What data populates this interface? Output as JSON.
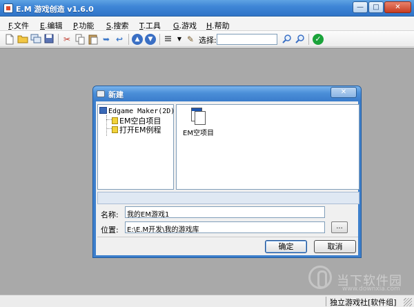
{
  "window": {
    "title": "E.M 游戏创造 v1.6.0",
    "buttons": {
      "minimize": "—",
      "maximize": "□",
      "close": "✕"
    }
  },
  "menu": {
    "items": [
      {
        "key": "F",
        "label": ".文件"
      },
      {
        "key": "E",
        "label": ".编辑"
      },
      {
        "key": "P",
        "label": ".功能"
      },
      {
        "key": "S",
        "label": ".搜索"
      },
      {
        "key": "T",
        "label": ".工具"
      },
      {
        "key": "G",
        "label": ".游戏"
      },
      {
        "key": "H",
        "label": ".帮助"
      }
    ]
  },
  "toolbar": {
    "select_label": "选择:",
    "select_value": "",
    "icons": [
      "new-file-icon",
      "open-folder-icon",
      "copy-window-icon",
      "save-icon",
      "cut-icon",
      "copy-icon",
      "paste-icon",
      "redo-icon",
      "undo-icon",
      "arrow-up-icon",
      "arrow-down-icon",
      "layers-icon",
      "dropdown-icon",
      "edit-icon",
      "zoom-icon",
      "search-icon",
      "check-icon"
    ]
  },
  "dialog": {
    "title": "新建",
    "close": "✕",
    "tree": {
      "root": "Edgame Maker(2D)",
      "items": [
        "EM空白项目",
        "打开EM例程"
      ]
    },
    "templates": [
      {
        "label": "EM空项目"
      }
    ],
    "fields": {
      "name_label": "名称:",
      "name_value": "我的EM游戏1",
      "location_label": "位置:",
      "location_value": "E:\\E.M开发\\我的游戏库",
      "browse_label": "..."
    },
    "buttons": {
      "ok": "确定",
      "cancel": "取消"
    }
  },
  "status": {
    "text": "独立游戏社[软件组]"
  },
  "watermark": {
    "text": "当下软件园",
    "url": "www.downxia.com"
  },
  "colors": {
    "titlebar": "#3f86d6",
    "workspace": "#a9a9a9",
    "dialog_frame": "#3d7fcc",
    "accent_green": "#1aa33a"
  }
}
